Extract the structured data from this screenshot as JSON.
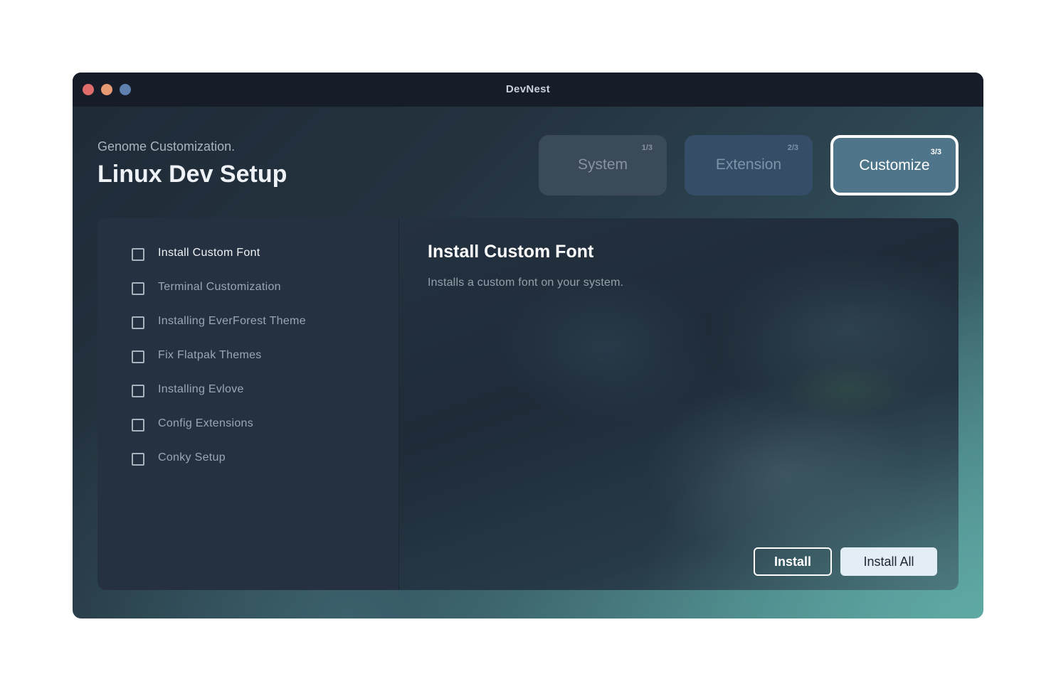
{
  "window": {
    "title": "DevNest",
    "controls": [
      "close",
      "minimize",
      "maximize"
    ]
  },
  "header": {
    "subtitle": "Genome Customization.",
    "title": "Linux Dev Setup"
  },
  "steps": [
    {
      "label": "System",
      "counter": "1/3",
      "state": "inactive"
    },
    {
      "label": "Extension",
      "counter": "2/3",
      "state": "inactive"
    },
    {
      "label": "Customize",
      "counter": "3/3",
      "state": "active"
    }
  ],
  "tasks": [
    {
      "label": "Install Custom Font",
      "checked": false,
      "selected": true
    },
    {
      "label": "Terminal Customization",
      "checked": false,
      "selected": false
    },
    {
      "label": "Installing EverForest Theme",
      "checked": false,
      "selected": false
    },
    {
      "label": "Fix Flatpak Themes",
      "checked": false,
      "selected": false
    },
    {
      "label": "Installing Evlove",
      "checked": false,
      "selected": false
    },
    {
      "label": "Config Extensions",
      "checked": false,
      "selected": false
    },
    {
      "label": "Conky Setup",
      "checked": false,
      "selected": false
    }
  ],
  "detail": {
    "title": "Install Custom Font",
    "description": "Installs a custom font on your system."
  },
  "actions": {
    "install_label": "Install",
    "install_all_label": "Install All"
  }
}
